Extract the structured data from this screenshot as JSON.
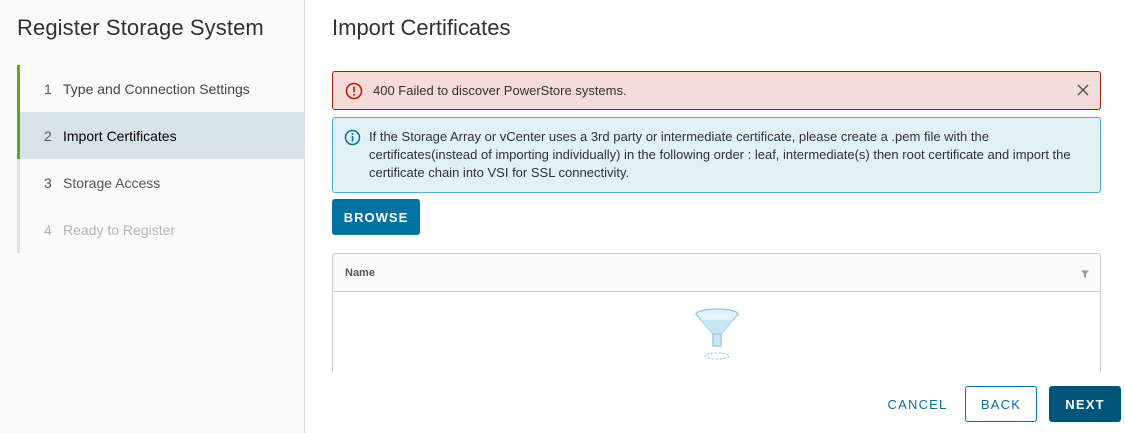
{
  "wizard": {
    "title": "Register Storage System",
    "steps": [
      {
        "num": "1",
        "label": "Type and Connection Settings"
      },
      {
        "num": "2",
        "label": "Import Certificates"
      },
      {
        "num": "3",
        "label": "Storage Access"
      },
      {
        "num": "4",
        "label": "Ready to Register"
      }
    ]
  },
  "main": {
    "title": "Import Certificates",
    "error_alert": {
      "text": "400 Failed to discover PowerStore systems.",
      "icon": "error-circle-icon",
      "close_icon": "close-icon"
    },
    "info_alert": {
      "text": "If the Storage Array or vCenter uses a 3rd party or intermediate certificate, please create a .pem file with the certificates(instead of importing individually) in the following order : leaf, intermediate(s) then root certificate and import the certificate chain into VSI for SSL connectivity.",
      "icon": "info-circle-icon"
    },
    "browse_label": "BROWSE",
    "grid": {
      "columns": [
        "Name"
      ],
      "filter_icon": "filter-icon",
      "empty_icon": "empty-filter-funnel-icon",
      "rows": []
    }
  },
  "footer": {
    "cancel_label": "CANCEL",
    "back_label": "BACK",
    "next_label": "NEXT"
  },
  "colors": {
    "accent": "#0072a3",
    "primary_dark": "#00567a",
    "step_complete": "#62a420",
    "error_bg": "#f5dbd9",
    "error_border": "#a32100",
    "info_bg": "#e1f1f6",
    "info_border": "#49afd9"
  }
}
